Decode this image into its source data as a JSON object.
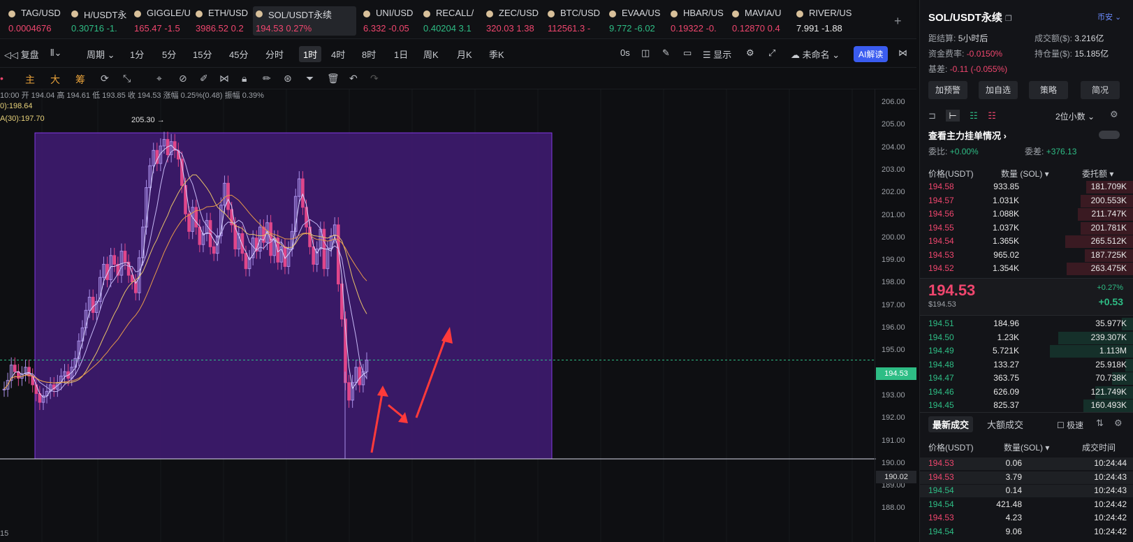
{
  "tickers": [
    {
      "sym": "TAG/USD",
      "price": "0.0004676",
      "color": "red"
    },
    {
      "sym": "H/USDT永",
      "price": "0.30716 -1.",
      "color": "green"
    },
    {
      "sym": "GIGGLE/U",
      "price": "165.47 -1.5",
      "color": "red"
    },
    {
      "sym": "ETH/USD",
      "price": "3986.52 0.2",
      "color": "red"
    },
    {
      "sym": "SOL/USDT永续",
      "price": "194.53 0.27%",
      "color": "red"
    },
    {
      "sym": "UNI/USD",
      "price": "6.332 -0.05",
      "color": "red"
    },
    {
      "sym": "RECALL/",
      "price": "0.40204 3.1",
      "color": "green"
    },
    {
      "sym": "ZEC/USD",
      "price": "320.03 1.38",
      "color": "red"
    },
    {
      "sym": "BTC/USD",
      "price": "112561.3 -",
      "color": "red"
    },
    {
      "sym": "EVAA/US",
      "price": "9.772 -6.02",
      "color": "green"
    },
    {
      "sym": "HBAR/US",
      "price": "0.19322 -0.",
      "color": "red"
    },
    {
      "sym": "MAVIA/U",
      "price": "0.12870 0.4",
      "color": "red"
    },
    {
      "sym": "RIVER/US",
      "price": "7.991 -1.88",
      "color": "white"
    }
  ],
  "toolbar": {
    "replay": "复盘",
    "period": "周期",
    "tf": [
      "1分",
      "5分",
      "15分",
      "45分",
      "分时",
      "1时",
      "4时",
      "8时",
      "1日",
      "周K",
      "月K",
      "季K"
    ],
    "selected": "1时",
    "zero": "0s",
    "display": "显示",
    "unnamed": "未命名",
    "ai": "AI解读"
  },
  "drawbar": {
    "main": "主",
    "big": "大",
    "chou": "筹"
  },
  "chart": {
    "ohlc": "10:00 开 194.04 高 194.61 低 193.85 收 194.53 涨幅 0.25%(0.48) 振幅 0.39%",
    "ma1": "0):198.64",
    "ma2": "A(30):197.70",
    "high_label": "205.30 →",
    "current": "194.53",
    "low_tag": "190.02",
    "bottom": "15",
    "ticks": [
      "206.00",
      "205.00",
      "204.00",
      "203.00",
      "202.00",
      "201.00",
      "200.00",
      "199.00",
      "198.00",
      "197.00",
      "196.00",
      "195.00",
      "194.00",
      "193.00",
      "192.00",
      "191.00",
      "190.00",
      "189.00",
      "188.00"
    ]
  },
  "chart_data": {
    "type": "candlestick",
    "y_axis_range": [
      187.5,
      206.5
    ],
    "current_price": 194.53,
    "high": 205.3,
    "low": 190.02,
    "ohlc_latest": {
      "open": 194.04,
      "high": 194.61,
      "low": 193.85,
      "close": 194.53
    }
  },
  "panel": {
    "title": "SOL/USDT永续",
    "exchange": "币安",
    "settle_label": "距结算:",
    "settle": "5小时后",
    "volume_label": "成交额($):",
    "volume": "3.216亿",
    "funding_label": "资金费率:",
    "funding": "-0.0150%",
    "oi_label": "持仓量($):",
    "oi": "15.185亿",
    "basis_label": "基差:",
    "basis": "-0.11 (-0.055%)",
    "buttons": [
      "加预警",
      "加自选",
      "策略",
      "简况"
    ],
    "decimals": "2位小数",
    "main_orders": "查看主力挂单情况",
    "ratio_label": "委比:",
    "ratio": "+0.00%",
    "diff_label": "委差:",
    "diff": "+376.13",
    "col_price": "价格(USDT)",
    "col_qty": "数量 (SOL)",
    "col_total": "委托额",
    "asks": [
      {
        "p": "194.58",
        "q": "933.85",
        "t": "181.709K"
      },
      {
        "p": "194.57",
        "q": "1.031K",
        "t": "200.553K"
      },
      {
        "p": "194.56",
        "q": "1.088K",
        "t": "211.747K"
      },
      {
        "p": "194.55",
        "q": "1.037K",
        "t": "201.781K"
      },
      {
        "p": "194.54",
        "q": "1.365K",
        "t": "265.512K"
      },
      {
        "p": "194.53",
        "q": "965.02",
        "t": "187.725K"
      },
      {
        "p": "194.52",
        "q": "1.354K",
        "t": "263.475K"
      }
    ],
    "last": "194.53",
    "last_usd": "$194.53",
    "chg_pct": "+0.27%",
    "chg": "+0.53",
    "bids": [
      {
        "p": "194.51",
        "q": "184.96",
        "t": "35.977K"
      },
      {
        "p": "194.50",
        "q": "1.23K",
        "t": "239.307K"
      },
      {
        "p": "194.49",
        "q": "5.721K",
        "t": "1.113M"
      },
      {
        "p": "194.48",
        "q": "133.27",
        "t": "25.918K"
      },
      {
        "p": "194.47",
        "q": "363.75",
        "t": "70.738K"
      },
      {
        "p": "194.46",
        "q": "626.09",
        "t": "121.749K"
      },
      {
        "p": "194.45",
        "q": "825.37",
        "t": "160.493K"
      }
    ],
    "tab_trades": "最新成交",
    "tab_big": "大额成交",
    "fast": "极速",
    "tcol_price": "价格(USDT)",
    "tcol_qty": "数量(SOL)",
    "tcol_time": "成交时间",
    "trades": [
      {
        "p": "194.53",
        "q": "0.06",
        "t": "10:24:44",
        "c": "red"
      },
      {
        "p": "194.53",
        "q": "3.79",
        "t": "10:24:43",
        "c": "red"
      },
      {
        "p": "194.54",
        "q": "0.14",
        "t": "10:24:43",
        "c": "green"
      },
      {
        "p": "194.54",
        "q": "421.48",
        "t": "10:24:42",
        "c": "green"
      },
      {
        "p": "194.53",
        "q": "4.23",
        "t": "10:24:42",
        "c": "red"
      },
      {
        "p": "194.54",
        "q": "9.06",
        "t": "10:24:42",
        "c": "green"
      }
    ]
  }
}
